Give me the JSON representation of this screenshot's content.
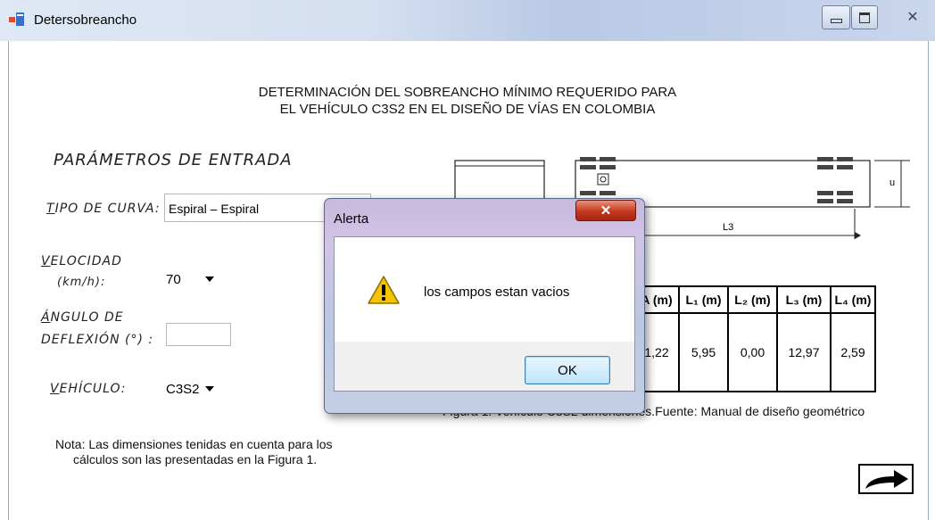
{
  "window": {
    "title": "Detersobreancho"
  },
  "header": {
    "line1": "DETERMINACIÓN DEL SOBREANCHO MÍNIMO REQUERIDO PARA",
    "line2": "EL VEHÍCULO C3S2 EN EL DISEÑO DE VÍAS EN COLOMBIA"
  },
  "form": {
    "section_title": "PARÁMETROS DE ENTRADA",
    "curve_type": {
      "label_first": "T",
      "label_rest": "IPO DE CURVA:",
      "value": "Espiral – Espiral"
    },
    "speed": {
      "label_first": "V",
      "label_rest": "ELOCIDAD",
      "unit": "(km/h):",
      "value": "70"
    },
    "angle": {
      "label_first": "Á",
      "label_rest": "NGULO DE",
      "label_line2": "DEFLEXIÓN (°) :",
      "value": ""
    },
    "vehicle": {
      "label_first": "V",
      "label_rest": "EHÍCULO:",
      "value": "C3S2"
    }
  },
  "note": {
    "line1": "Nota: Las dimensiones tenidas en cuenta para los",
    "line2": "cálculos son las presentadas en la Figura 1."
  },
  "diagram": {
    "label_L3": "L3",
    "label_u": "u"
  },
  "dimensions_table": {
    "headers": [
      "A (m)",
      "L₁ (m)",
      "L₂ (m)",
      "L₃ (m)",
      "L₄ (m)"
    ],
    "values": [
      "1,22",
      "5,95",
      "0,00",
      "12,97",
      "2,59"
    ]
  },
  "figure_caption": "Figura 1. Vehículo C3S2 dimensiones.Fuente: Manual de diseño geométrico",
  "dialog": {
    "title": "Alerta",
    "message": "los campos estan vacios",
    "ok_label": "OK"
  }
}
